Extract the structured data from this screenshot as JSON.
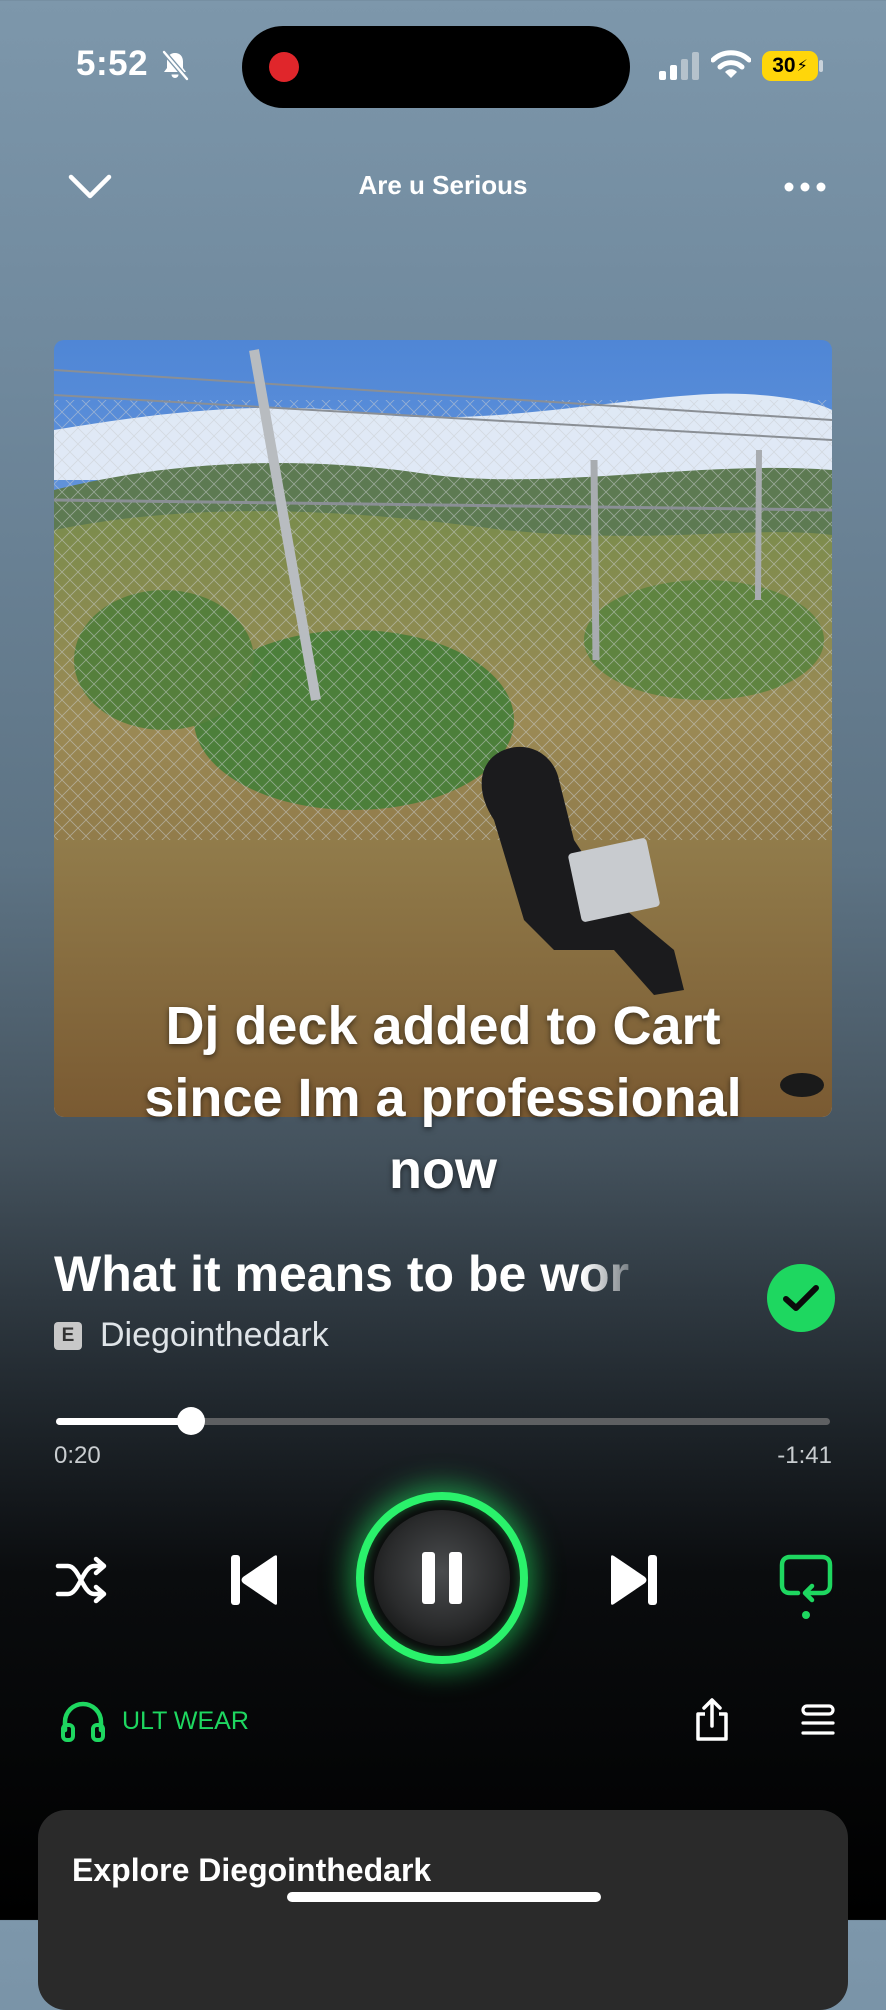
{
  "status_bar": {
    "time": "5:52",
    "battery": "30"
  },
  "header": {
    "title": "Are u Serious"
  },
  "album_art": {
    "caption": "Dj deck added to Cart since Im a professional now"
  },
  "track": {
    "title": "What it means to be wor",
    "explicit_badge": "E",
    "artist": "Diegointhedark",
    "saved": true
  },
  "progress": {
    "elapsed": "0:20",
    "remaining": "-1:41",
    "fraction": 0.175
  },
  "device": {
    "label": "ULT WEAR"
  },
  "explore": {
    "title": "Explore Diegointhedark"
  },
  "colors": {
    "accent": "#1ed760",
    "recording": "#e0262b",
    "battery": "#ffd60a"
  },
  "icons": [
    "bell-slash-icon",
    "signal-icon",
    "wifi-icon",
    "battery-icon",
    "chevron-down-icon",
    "more-icon",
    "check-icon",
    "shuffle-icon",
    "previous-icon",
    "pause-icon",
    "next-icon",
    "repeat-icon",
    "headphones-icon",
    "share-icon",
    "queue-icon"
  ]
}
